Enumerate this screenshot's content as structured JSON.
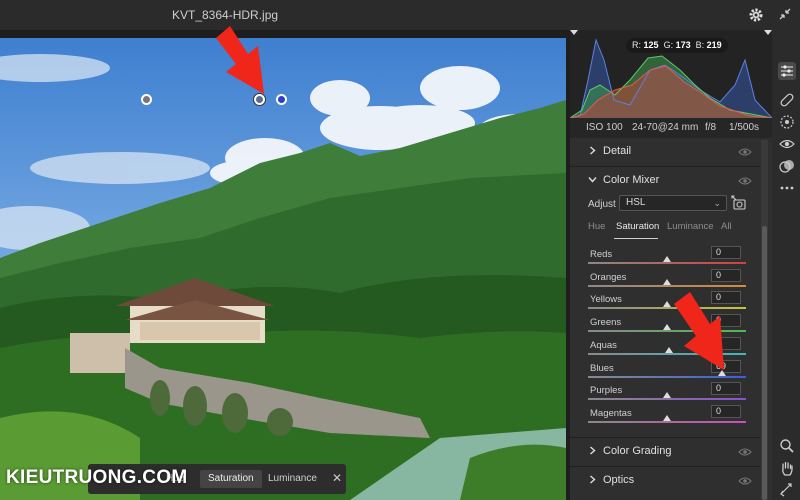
{
  "window": {
    "filename": "KVT_8364-HDR.jpg"
  },
  "histogram": {
    "r": "125",
    "g": "173",
    "b": "219",
    "r_label": "R:",
    "g_label": "G:",
    "b_label": "B:"
  },
  "exif": {
    "iso": "ISO 100",
    "lens": "24-70@24 mm",
    "aperture": "f/8",
    "shutter": "1/500s"
  },
  "sections": {
    "detail": "Detail",
    "color_mixer": "Color Mixer",
    "color_grading": "Color Grading",
    "optics": "Optics"
  },
  "color_mixer": {
    "adjust_label": "Adjust",
    "adjust_value": "HSL",
    "tabs": [
      "Hue",
      "Saturation",
      "Luminance",
      "All"
    ],
    "active_tab": "Saturation",
    "sliders": [
      {
        "label": "Reds",
        "value": "0",
        "level": 0,
        "color": "#d04040"
      },
      {
        "label": "Oranges",
        "value": "0",
        "level": 0,
        "color": "#d78a3a"
      },
      {
        "label": "Yellows",
        "value": "0",
        "level": 0,
        "color": "#c9c23c"
      },
      {
        "label": "Greens",
        "value": "0",
        "level": 0,
        "color": "#4fb84f"
      },
      {
        "label": "Aquas",
        "value": "3",
        "level": 3,
        "color": "#3fb7c0"
      },
      {
        "label": "Blues",
        "value": "69",
        "level": 69,
        "color": "#3b5fd9"
      },
      {
        "label": "Purples",
        "value": "0",
        "level": 0,
        "color": "#8a4fcf"
      },
      {
        "label": "Magentas",
        "value": "0",
        "level": 0,
        "color": "#c84fb4"
      }
    ]
  },
  "floating_bar": {
    "hue": "Hue",
    "saturation": "Saturation",
    "luminance": "Luminance",
    "close": "✕"
  },
  "watermark": "KIEUTRUONG.COM",
  "icons": [
    "gear-icon",
    "collapse-icon",
    "edit-sliders-icon",
    "healing-brush-icon",
    "masking-icon",
    "red-eye-icon",
    "presets-icon",
    "more-icon",
    "zoom-icon",
    "hand-icon",
    "eye-icon",
    "target-adjust-icon",
    "chevron-right-icon",
    "chevron-down-icon"
  ]
}
